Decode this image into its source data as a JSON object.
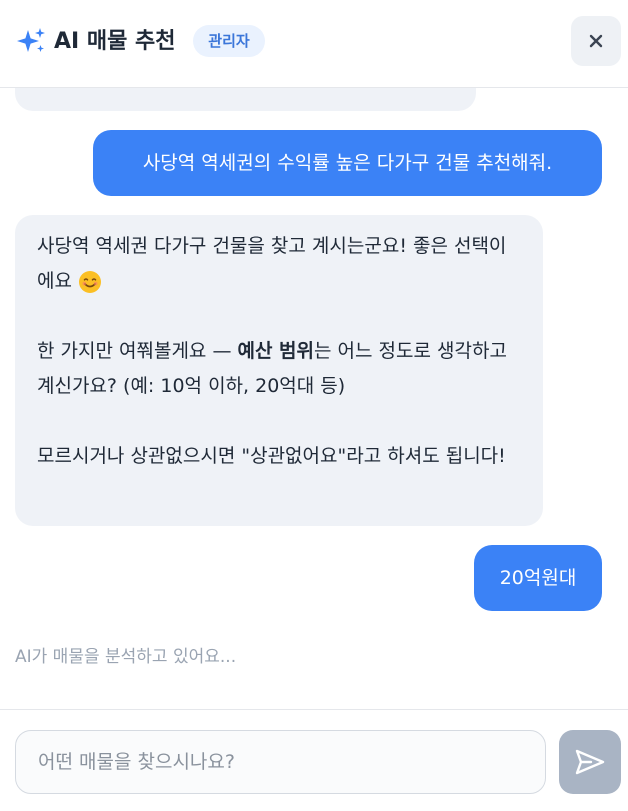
{
  "header": {
    "sparkle_icon": "sparkles-icon",
    "title": "AI 매물 추천",
    "badge": "관리자",
    "close_icon": "close-icon"
  },
  "messages": [
    {
      "role": "assistant",
      "partial": true,
      "paragraphs": []
    },
    {
      "role": "user",
      "text": "사당역 역세권의 수익률 높은 다가구 건물 추천해줘."
    },
    {
      "role": "assistant",
      "paragraphs": [
        {
          "text": "사당역 역세권 다가구 건물을 찾고 계시는군요! 좋은 선택이에요",
          "emoji": "😊"
        },
        {
          "before": "한 가지만 여쭤볼게요 — ",
          "bold": "예산 범위",
          "after": "는 어느 정도로 생각하고 계신가요? (예: 10억 이하, 20억대 등)"
        },
        {
          "text": "모르시거나 상관없으시면 \"상관없어요\"라고 하셔도 됩니다!"
        }
      ]
    },
    {
      "role": "user",
      "text": "20억원대"
    }
  ],
  "status": {
    "typing": "AI가 매물을 분석하고 있어요..."
  },
  "input": {
    "placeholder": "어떤 매물을 찾으시나요?",
    "value": "",
    "send_icon": "send-icon"
  },
  "colors": {
    "accent": "#3b82f6",
    "assistant_bubble": "#eff2f7",
    "badge_bg": "#eaf2fe",
    "badge_text": "#3b76d9",
    "send_disabled": "#a9b4c4"
  }
}
